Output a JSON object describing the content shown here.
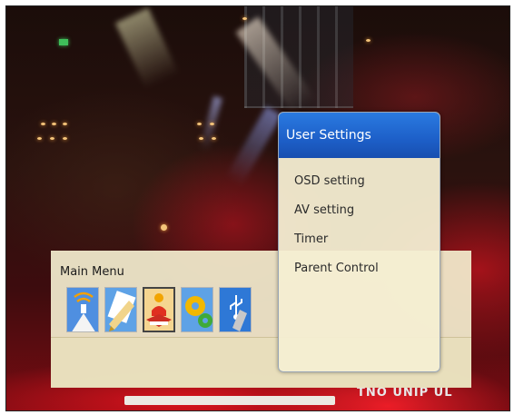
{
  "main_menu": {
    "title": "Main Menu",
    "icons": [
      {
        "name": "broadcast-tv-icon",
        "selected": false
      },
      {
        "name": "program-guide-icon",
        "selected": false
      },
      {
        "name": "user-settings-icon",
        "selected": true
      },
      {
        "name": "system-settings-icon",
        "selected": false
      },
      {
        "name": "usb-media-icon",
        "selected": false
      }
    ]
  },
  "user_settings": {
    "title": "User Settings",
    "items": [
      {
        "label": "OSD setting"
      },
      {
        "label": "AV setting"
      },
      {
        "label": "Timer"
      },
      {
        "label": "Parent Control"
      }
    ]
  },
  "broadcast": {
    "logo_text": "TNO UNIP UL"
  },
  "colors": {
    "header_blue": "#1d5fc8",
    "menu_cream": "#f2ecce",
    "stage_red": "#c8101c"
  }
}
